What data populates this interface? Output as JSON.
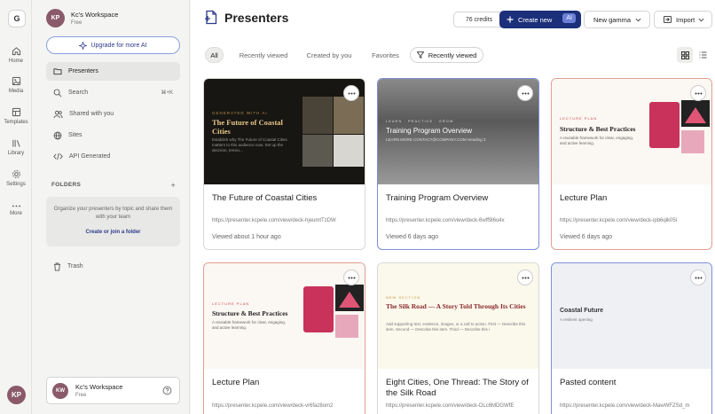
{
  "rail": {
    "logo": "G",
    "items": [
      {
        "label": "Home",
        "icon": "home-icon"
      },
      {
        "label": "Media",
        "icon": "image-icon"
      },
      {
        "label": "Templates",
        "icon": "templates-icon"
      },
      {
        "label": "Library",
        "icon": "library-icon"
      },
      {
        "label": "Settings",
        "icon": "gear-icon"
      },
      {
        "label": "More",
        "icon": "more-dots-icon"
      }
    ],
    "avatar": "KP"
  },
  "sidebar": {
    "workspace": {
      "initials": "KP",
      "name": "Kc's Workspace",
      "plan": "Free"
    },
    "upgrade_label": "Upgrade for more AI",
    "nav": [
      {
        "label": "Presenters",
        "icon": "folder-icon",
        "active": true
      },
      {
        "label": "Search",
        "icon": "search-icon",
        "shortcut": "⌘+K"
      },
      {
        "label": "Shared with you",
        "icon": "users-icon"
      },
      {
        "label": "Sites",
        "icon": "globe-icon"
      },
      {
        "label": "API Generated",
        "icon": "code-icon"
      }
    ],
    "folders_heading": "FOLDERS",
    "folders_add": "+",
    "folders_empty_text": "Organize your presenters by topic and share them with your team",
    "folders_link": "Create or join a folder",
    "trash_label": "Trash",
    "bottom_workspace": {
      "initials": "KW",
      "name": "Kc's Workspace",
      "plan": "Free"
    }
  },
  "header": {
    "title": "Presenters",
    "credits": "76 credits",
    "create_label": "Create new",
    "create_badge": "AI",
    "new_gamma_label": "New gamma",
    "import_label": "Import"
  },
  "filters": [
    {
      "label": "All",
      "active": true
    },
    {
      "label": "Recently viewed"
    },
    {
      "label": "Created by you"
    },
    {
      "label": "Favorites"
    },
    {
      "label": "Recently viewed",
      "icon": "filter-icon"
    }
  ],
  "cards": [
    {
      "title": "The Future of Coastal Cities",
      "url": "https://presenter.kcpele.com/view/deck-hjeumtTzDW",
      "viewed": "Viewed about 1 hour ago",
      "thumb": {
        "eyebrow": "GENERATED WITH AI",
        "heading": "The Future of Coastal Cities",
        "sub": "Establish why The Future of Coastal Cities matters to this audience now. Set up the decision, tensio..."
      }
    },
    {
      "title": "Training Program Overview",
      "url": "https://presenter.kcpele.com/view/deck-6wff9l6o4x",
      "viewed": "Viewed 6 days ago",
      "thumb": {
        "eyebrow": "LEARN · PRACTICE · GROW",
        "heading": "Training Program Overview",
        "sub": "LEARN MORE CONTACT@COMPANY.COM Heading 3"
      }
    },
    {
      "title": "Lecture Plan",
      "url": "https://presenter.kcpele.com/view/deck-ipb6qlk05l",
      "viewed": "Viewed 6 days ago",
      "thumb": {
        "eyebrow": "LECTURE PLAN",
        "heading": "Structure & Best Practices",
        "sub": "A reusable framework for clear, engaging, and active learning."
      }
    },
    {
      "title": "Lecture Plan",
      "url": "https://presenter.kcpele.com/view/deck-vr6faz8om2",
      "viewed": "",
      "thumb": {
        "eyebrow": "LECTURE PLAN",
        "heading": "Structure & Best Practices",
        "sub": "A reusable framework for clear, engaging, and active learning."
      }
    },
    {
      "title": "Eight Cities, One Thread: The Story of the Silk Road",
      "url": "https://presenter.kcpele.com/view/deck-DLc6MDGWfE",
      "viewed": "",
      "thumb": {
        "eyebrow": "NEW SECTION",
        "heading": "The Silk Road — A Story Told Through Its Cities",
        "sub": "Add supporting text, evidence, images, or a call to action. First — Describe this item. Second — Describe this item. Third — Describe this i"
      }
    },
    {
      "title": "Pasted content",
      "url": "https://presenter.kcpele.com/view/deck-MawWFZSd_m",
      "viewed": "",
      "thumb": {
        "heading": "Coastal Future",
        "sub": "A resilient opening"
      }
    }
  ]
}
